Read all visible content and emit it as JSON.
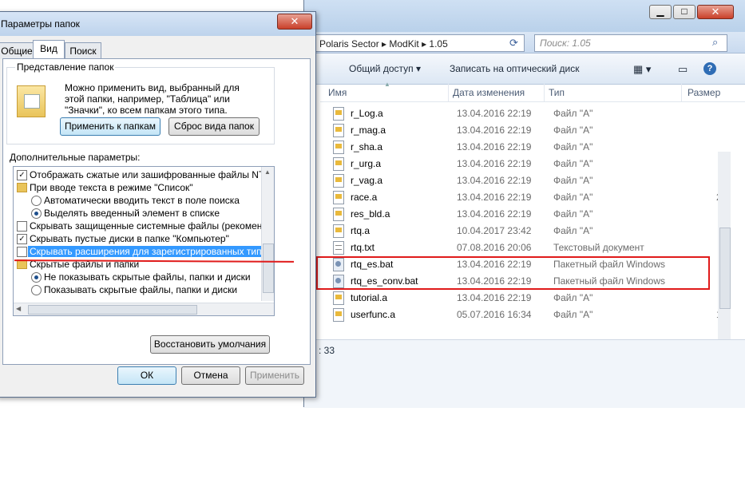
{
  "explorer": {
    "address": "Polaris Sector  ▸  ModKit  ▸  1.05",
    "search_placeholder": "Поиск: 1.05",
    "toolbar": {
      "share": "Общий доступ",
      "burn": "Записать на оптический диск"
    },
    "columns": {
      "name": "Имя",
      "date": "Дата изменения",
      "type": "Тип",
      "size": "Размер"
    },
    "files": [
      {
        "name": "r_Log.a",
        "date": "13.04.2016 22:19",
        "type": "Файл \"A\"",
        "size": ""
      },
      {
        "name": "r_mag.a",
        "date": "13.04.2016 22:19",
        "type": "Файл \"A\"",
        "size": ""
      },
      {
        "name": "r_sha.a",
        "date": "13.04.2016 22:19",
        "type": "Файл \"A\"",
        "size": ""
      },
      {
        "name": "r_urg.a",
        "date": "13.04.2016 22:19",
        "type": "Файл \"A\"",
        "size": ""
      },
      {
        "name": "r_vag.a",
        "date": "13.04.2016 22:19",
        "type": "Файл \"A\"",
        "size": ""
      },
      {
        "name": "race.a",
        "date": "13.04.2016 22:19",
        "type": "Файл \"A\"",
        "size": "2"
      },
      {
        "name": "res_bld.a",
        "date": "13.04.2016 22:19",
        "type": "Файл \"A\"",
        "size": ""
      },
      {
        "name": "rtq.a",
        "date": "10.04.2017 23:42",
        "type": "Файл \"A\"",
        "size": ""
      },
      {
        "name": "rtq.txt",
        "date": "07.08.2016 20:06",
        "type": "Текстовый документ",
        "size": ""
      },
      {
        "name": "rtq_es.bat",
        "date": "13.04.2016 22:19",
        "type": "Пакетный файл Windows",
        "size": ""
      },
      {
        "name": "rtq_es_conv.bat",
        "date": "13.04.2016 22:19",
        "type": "Пакетный файл Windows",
        "size": ""
      },
      {
        "name": "tutorial.a",
        "date": "13.04.2016 22:19",
        "type": "Файл \"A\"",
        "size": ""
      },
      {
        "name": "userfunc.a",
        "date": "05.07.2016 16:34",
        "type": "Файл \"A\"",
        "size": "1"
      }
    ],
    "status": ": 33"
  },
  "dialog": {
    "title": "Параметры папок",
    "tabs": [
      "Общие",
      "Вид",
      "Поиск"
    ],
    "group_title": "Представление папок",
    "group_desc": "Можно применить вид, выбранный для этой папки, например, \"Таблица\" или \"Значки\", ко всем папкам этого типа.",
    "apply_to_folders": "Применить к папкам",
    "reset_folders": "Сброс вида папок",
    "advanced_label": "Дополнительные параметры:",
    "advanced": [
      {
        "kind": "check",
        "checked": true,
        "label": "Отображать сжатые или зашифрованные файлы NTI"
      },
      {
        "kind": "folder",
        "label": "При вводе текста в режиме \"Список\""
      },
      {
        "kind": "radio",
        "checked": false,
        "label": "Автоматически вводить текст в поле поиска"
      },
      {
        "kind": "radio",
        "checked": true,
        "label": "Выделять введенный элемент в списке"
      },
      {
        "kind": "check",
        "checked": false,
        "label": "Скрывать защищенные системные файлы (рекомен,"
      },
      {
        "kind": "check",
        "checked": true,
        "label": "Скрывать пустые диски в папке \"Компьютер\""
      },
      {
        "kind": "check",
        "checked": false,
        "label": "Скрывать расширения для зарегистрированных типо",
        "selected": true
      },
      {
        "kind": "folder",
        "label": "Скрытые файлы и папки"
      },
      {
        "kind": "radio",
        "checked": true,
        "label": "Не показывать скрытые файлы, папки и диски"
      },
      {
        "kind": "radio",
        "checked": false,
        "label": "Показывать скрытые файлы, папки и диски"
      }
    ],
    "restore_defaults": "Восстановить умолчания",
    "ok": "ОК",
    "cancel": "Отмена",
    "apply": "Применить"
  },
  "colors": {
    "highlight": "#3399ff",
    "annotation_red": "#e01b1b"
  }
}
